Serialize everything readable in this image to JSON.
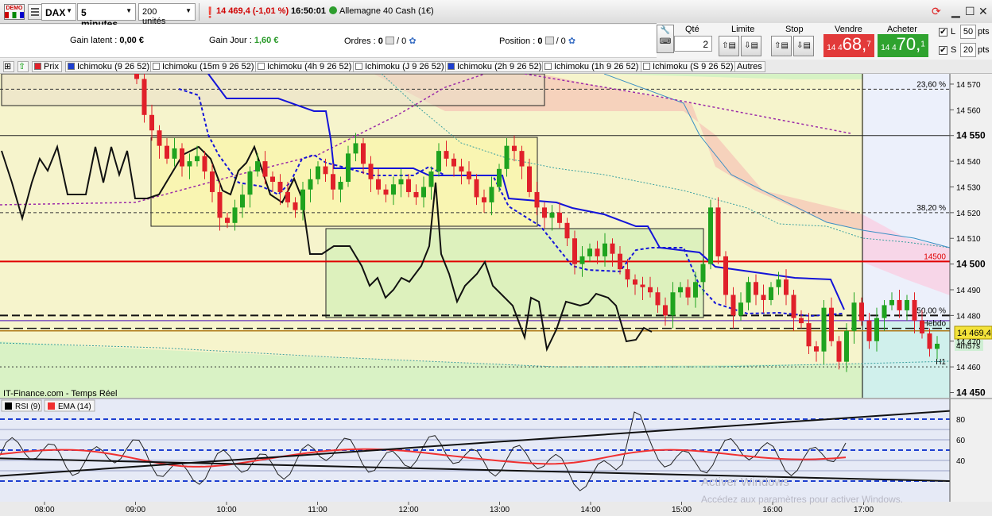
{
  "toolbar": {
    "demo_label": "DEMO",
    "instrument": "DAX",
    "timeframe": "5 minutes",
    "units": "200 unités",
    "price_change": "14 469,4 (-1,01 %)",
    "time": "16:50:01",
    "market_name": "Allemagne 40 Cash (1€)"
  },
  "info": {
    "gain_latent_label": "Gain latent :",
    "gain_latent_value": "0,00 €",
    "gain_jour_label": "Gain Jour :",
    "gain_jour_value": "1,60 €",
    "ordres_label": "Ordres :",
    "ordres_a": "0",
    "ordres_b": "/ 0",
    "position_label": "Position :",
    "position_a": "0",
    "position_b": "/ 0"
  },
  "order": {
    "qte_label": "Qté",
    "qte_value": "2",
    "limite_label": "Limite",
    "stop_label": "Stop",
    "vendre_label": "Vendre",
    "vendre_small": "14 4",
    "vendre_big": "68,",
    "vendre_sup": "7",
    "acheter_label": "Acheter",
    "acheter_small": "14 4",
    "acheter_big": "70,",
    "acheter_sup": "1",
    "l_label": "L",
    "l_value": "50",
    "s_label": "S",
    "s_value": "20",
    "pts": "pts"
  },
  "legend": {
    "prix": "Prix",
    "items": [
      "Ichimoku (9 26 52)",
      "Ichimoku (15m 9 26 52)",
      "Ichimoku (4h 9 26 52)",
      "Ichimoku (J 9 26 52)",
      "Ichimoku (2h 9 26 52)",
      "Ichimoku (1h 9 26 52)",
      "Ichimoku (S 9 26 52)"
    ],
    "autres": "Autres"
  },
  "chart_data": {
    "type": "candlestick",
    "source_label": "IT-Finance.com - Temps Réel",
    "y_ticks": [
      "14 570",
      "14 560",
      "14 550",
      "14 540",
      "14 530",
      "14 520",
      "14 510",
      "14 500",
      "14 490",
      "14 480",
      "14 470",
      "14 460",
      "14 450"
    ],
    "y_range": [
      14448,
      14574
    ],
    "x_ticks": [
      "08:00",
      "09:00",
      "10:00",
      "11:00",
      "12:00",
      "13:00",
      "14:00",
      "15:00",
      "16:00",
      "17:00"
    ],
    "levels": {
      "fib_23_6": {
        "label": "23,60 %",
        "value": 14568
      },
      "fib_38_2": {
        "label": "38,20 %",
        "value": 14520
      },
      "level_14500": {
        "label": "14500",
        "value": 14501
      },
      "fib_50": {
        "label": "50,00 %",
        "value": 14480
      },
      "hebdo": {
        "label": "Hebdo",
        "value": 14475
      },
      "h1": {
        "label": "H1",
        "value": 14460
      }
    },
    "last_price": "14 469,4",
    "countdown": "4m57s",
    "candles_close": [
      14572,
      14558,
      14552,
      14546,
      14541,
      14545,
      14538,
      14540,
      14542,
      14536,
      14528,
      14518,
      14516,
      14522,
      14527,
      14536,
      14540,
      14534,
      14532,
      14528,
      14524,
      14521,
      14529,
      14533,
      14538,
      14535,
      14529,
      14532,
      14543,
      14547,
      14539,
      14533,
      14529,
      14527,
      14531,
      14533,
      14528,
      14526,
      14530,
      14536,
      14544,
      14541,
      14538,
      14536,
      14533,
      14526,
      14524,
      14530,
      14537,
      14546,
      14544,
      14538,
      14528,
      14522,
      14518,
      14520,
      14516,
      14510,
      14500,
      14503,
      14506,
      14503,
      14508,
      14504,
      14498,
      14494,
      14492,
      14491,
      14489,
      14484,
      14480,
      14489,
      14491,
      14487,
      14493,
      14500,
      14522,
      14503,
      14488,
      14480,
      14485,
      14493,
      14488,
      14486,
      14491,
      14494,
      14488,
      14479,
      14477,
      14468,
      14466,
      14483,
      14470,
      14462,
      14474,
      14485,
      14478,
      14470,
      14479,
      14484,
      14486,
      14482,
      14486,
      14478,
      14473,
      14467,
      14469
    ],
    "rsi_panel": {
      "labels": [
        "RSI (9)",
        "EMA (14)"
      ],
      "ticks": [
        "80",
        "60",
        "40"
      ],
      "y_range": [
        0,
        100
      ]
    }
  },
  "watermark": {
    "line1": "Activer Windows",
    "line2": "Accédez aux paramètres pour activer Windows."
  },
  "colors": {
    "bull": "#1fa31f",
    "bear": "#e0202a",
    "kijun": "#0000dd",
    "tenkan": "#0000dd",
    "chikou": "#111111",
    "level_red": "#e00000",
    "cloud_red": "#f6d0b8",
    "cloud_green": "#d4f0c2",
    "rsi_ema": "#f03030"
  }
}
